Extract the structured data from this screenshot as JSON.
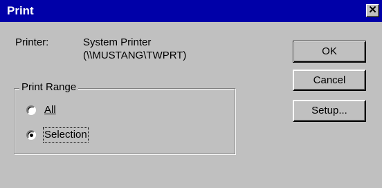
{
  "dialog": {
    "title": "Print",
    "close_icon_glyph": "✕"
  },
  "printer": {
    "label": "Printer:",
    "name": "System Printer",
    "path": "(\\\\MUSTANG\\TWPRT)"
  },
  "print_range": {
    "legend": "Print Range",
    "options": [
      {
        "label": "All",
        "selected": false
      },
      {
        "label": "Selection",
        "selected": true
      }
    ]
  },
  "buttons": {
    "ok": "OK",
    "cancel": "Cancel",
    "setup": "Setup..."
  },
  "colors": {
    "titlebar": "#0000a8",
    "face": "#c0c0c0"
  }
}
